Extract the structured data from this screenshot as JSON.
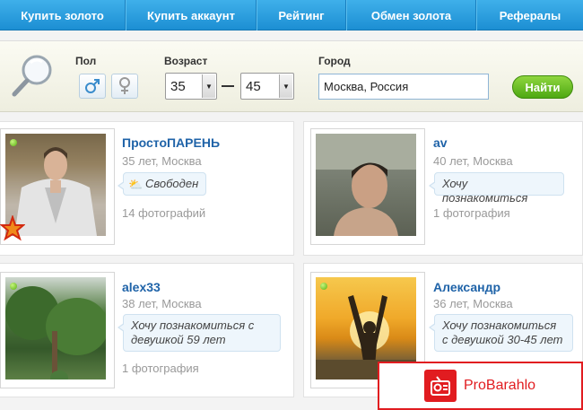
{
  "nav": {
    "items": [
      {
        "label": "Купить золото"
      },
      {
        "label": "Купить аккаунт"
      },
      {
        "label": "Рейтинг"
      },
      {
        "label": "Обмен золота"
      },
      {
        "label": "Рефералы"
      }
    ]
  },
  "search": {
    "gender_label": "Пол",
    "age_label": "Возраст",
    "age_from": "35",
    "age_to": "45",
    "city_label": "Город",
    "city_value": "Москва, Россия",
    "find_label": "Найти"
  },
  "profiles": [
    {
      "name": "ПростоПАРЕНЬ",
      "info": "35 лет, Москва",
      "status": "Свободен",
      "photos": "14 фотографий",
      "online": true
    },
    {
      "name": "av",
      "info": "40 лет, Москва",
      "status": "Хочу познакомиться",
      "photos": "1 фотография",
      "online": false
    },
    {
      "name": "alex33",
      "info": "38 лет, Москва",
      "status": "Хочу познакомиться с девушкой 59 лет",
      "photos": "1 фотография",
      "online": true
    },
    {
      "name": "Александр",
      "info": "36 лет, Москва",
      "status": "Хочу познакомиться с девушкой 30-45 лет",
      "photos": "",
      "online": true
    }
  ],
  "watermark": {
    "text": "ProBarahlo"
  },
  "colors": {
    "nav": "#1c8fd3",
    "link": "#1f63a8",
    "find": "#4ea812",
    "watermark": "#e11c20"
  }
}
